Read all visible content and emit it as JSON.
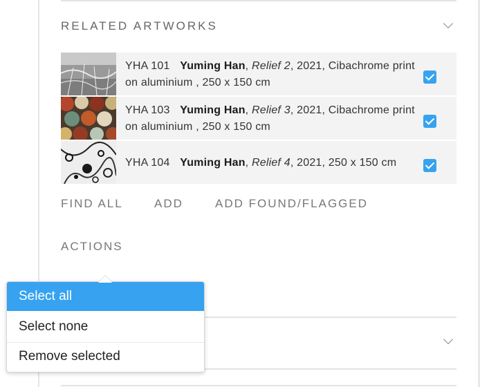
{
  "related_artworks": {
    "title": "RELATED ARTWORKS",
    "items": [
      {
        "code": "YHA 101",
        "artist": "Yuming Han",
        "title": "Relief 2",
        "details": ", 2021, Cibachrome print on aluminium , 250 x 150 cm",
        "checked": true
      },
      {
        "code": "YHA 103",
        "artist": "Yuming Han",
        "title": "Relief 3",
        "details": ", 2021, Cibachrome print on aluminium , 250 x 150 cm",
        "checked": true
      },
      {
        "code": "YHA 104",
        "artist": "Yuming Han",
        "title": "Relief 4",
        "details": ", 2021, 250 x 150 cm",
        "checked": true
      }
    ],
    "links": {
      "find_all": "FIND ALL",
      "add": "ADD",
      "add_found_flagged": "ADD FOUND/FLAGGED"
    },
    "actions_label": "ACTIONS"
  },
  "actions_menu": {
    "items": [
      {
        "label": "Select all",
        "active": true
      },
      {
        "label": "Select none",
        "active": false
      },
      {
        "label": "Remove selected",
        "active": false
      }
    ]
  },
  "colors": {
    "accent": "#36a2f0",
    "row_bg": "#f3f3f3",
    "muted_text": "#777777"
  },
  "icons": {
    "collapse": "chevron-down-icon",
    "checkbox": "checkbox-checked-icon"
  }
}
